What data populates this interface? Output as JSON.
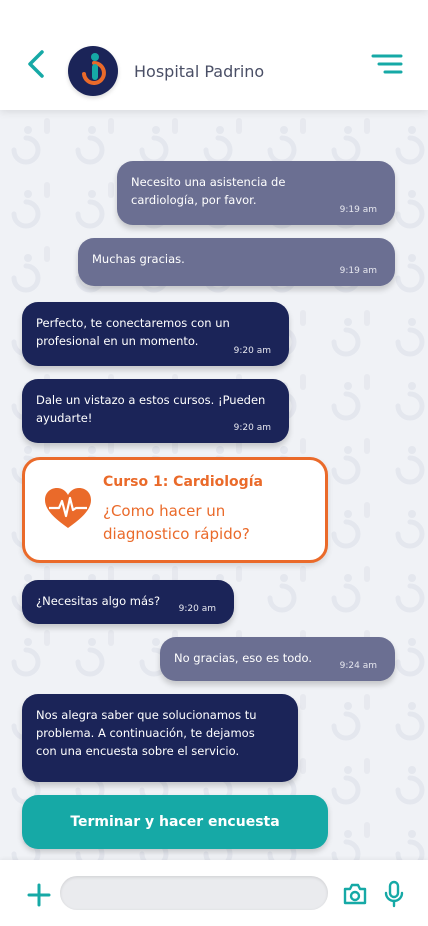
{
  "header": {
    "title": "Hospital Padrino",
    "back_icon": "chevron-left-icon",
    "menu_icon": "menu-icon",
    "avatar_icon": "hospital-logo-icon"
  },
  "colors": {
    "accent_teal": "#16a9a6",
    "accent_orange": "#ea6a2a",
    "navy": "#1b2458",
    "outgoing_bubble": "#6b6f92"
  },
  "messages": [
    {
      "direction": "outgoing",
      "text": "Necesito una asistencia de\ncardiología, por favor.",
      "time": "9:19 am"
    },
    {
      "direction": "outgoing",
      "text": "Muchas gracias.",
      "time": "9:19 am"
    },
    {
      "direction": "incoming",
      "text": "Perfecto, te conectaremos con un\nprofesional en un momento.",
      "time": "9:20 am"
    },
    {
      "direction": "incoming",
      "text": "Dale un vistazo a estos cursos. ¡Pueden\nayudarte!",
      "time": "9:20 am"
    },
    {
      "direction": "incoming",
      "text": "¿Necesitas algo más?",
      "time": "9:20 am"
    },
    {
      "direction": "outgoing",
      "text": "No gracias, eso es todo.",
      "time": "9:24 am"
    },
    {
      "direction": "incoming",
      "text": "Nos alegra saber que solucionamos tu\nproblema. A continuación, te dejamos\ncon una encuesta sobre el servicio.",
      "time": ""
    }
  ],
  "course_card": {
    "title": "Curso 1: Cardiología",
    "subtitle": "¿Como hacer un\ndiagnostico rápido?",
    "icon": "heart-pulse-icon"
  },
  "survey_button": {
    "label": "Terminar y hacer encuesta"
  },
  "composer": {
    "add_icon": "plus-icon",
    "input_value": "",
    "input_placeholder": "",
    "camera_icon": "camera-icon",
    "mic_icon": "microphone-icon"
  }
}
